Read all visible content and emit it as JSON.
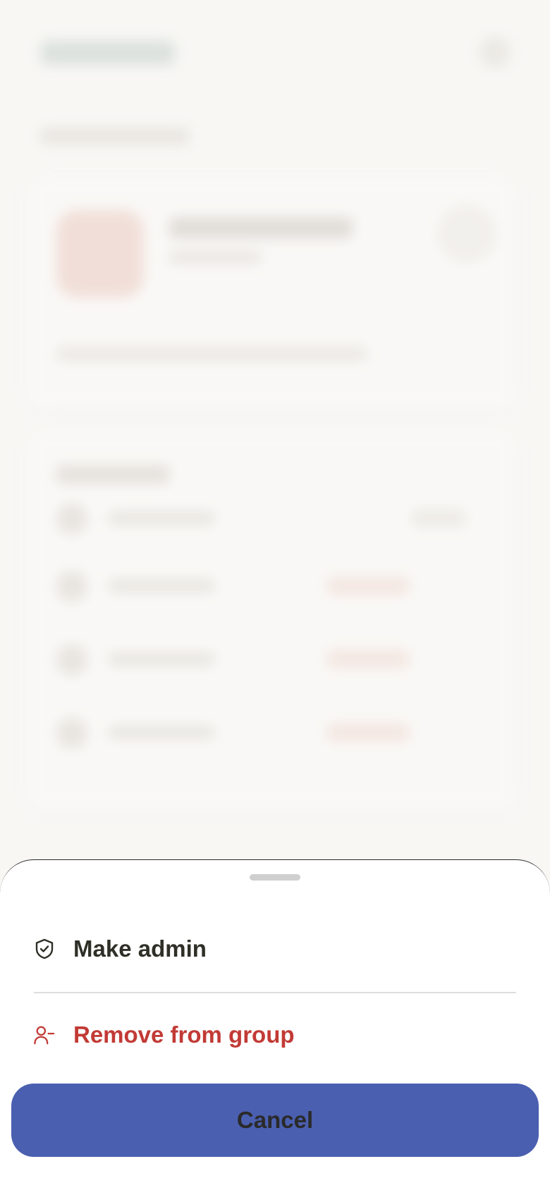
{
  "sheet": {
    "actions": [
      {
        "label": "Make admin",
        "icon": "shield-check-icon"
      },
      {
        "label": "Remove from group",
        "icon": "user-minus-icon"
      }
    ],
    "cancel_label": "Cancel"
  },
  "colors": {
    "primary_text": "#2f2f28",
    "danger": "#c23a35",
    "cancel_button": "#4a5fb0",
    "sheet_background": "#ffffff",
    "page_background": "#f8f7f4"
  }
}
